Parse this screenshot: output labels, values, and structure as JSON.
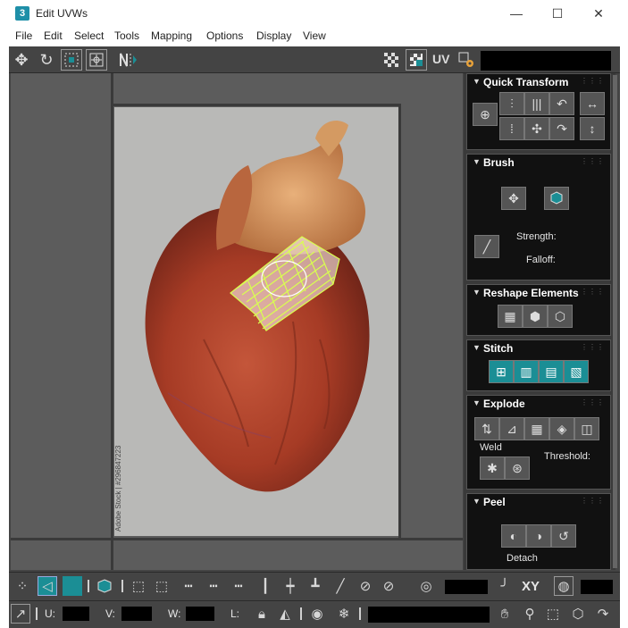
{
  "window": {
    "app_icon_glyph": "3",
    "title": "Edit UVWs",
    "minimize_glyph": "—",
    "maximize_glyph": "☐",
    "close_glyph": "✕"
  },
  "menu": {
    "items": [
      "File",
      "Edit",
      "Select",
      "Tools",
      "Mapping",
      "Options",
      "Display",
      "View"
    ]
  },
  "toolbar": {
    "uv_label": "UV"
  },
  "viewport": {
    "watermark": "Adobe Stock | #296847223"
  },
  "rollouts": {
    "quick_transform": {
      "title": "Quick Transform"
    },
    "brush": {
      "title": "Brush",
      "strength_label": "Strength:",
      "falloff_label": "Falloff:"
    },
    "reshape": {
      "title": "Reshape Elements"
    },
    "stitch": {
      "title": "Stitch"
    },
    "explode": {
      "title": "Explode",
      "weld_label": "Weld",
      "threshold_label": "Threshold:"
    },
    "peel": {
      "title": "Peel",
      "detach_label": "Detach"
    }
  },
  "bottom": {
    "xy_label": "XY",
    "u_label": "U:",
    "v_label": "V:",
    "w_label": "W:",
    "l_label": "L:"
  },
  "colors": {
    "panel_bg": "#444444",
    "rollout_bg": "#111111",
    "accent_teal": "#1b8e95",
    "uv_wire": "#c8ff3c"
  }
}
